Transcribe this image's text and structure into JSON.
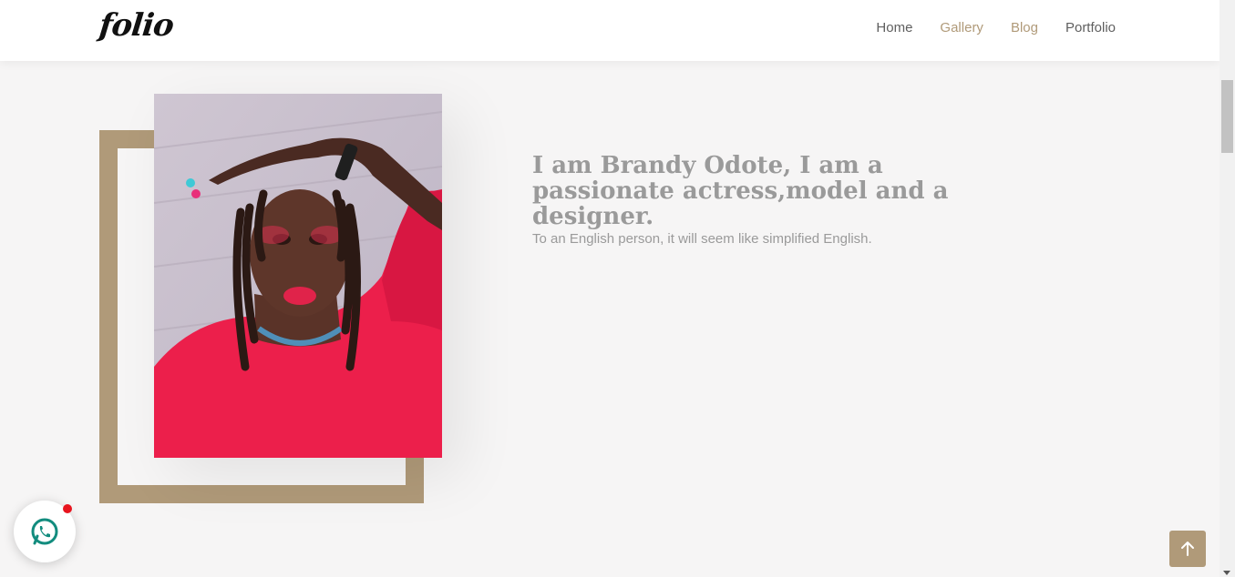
{
  "brand": {
    "logo_text": "folio"
  },
  "nav": {
    "items": [
      {
        "label": "Home",
        "color": "#5f5f5f"
      },
      {
        "label": "Gallery",
        "color": "#b09a79"
      },
      {
        "label": "Blog",
        "color": "#b09a79"
      },
      {
        "label": "Portfolio",
        "color": "#5f5f5f"
      }
    ]
  },
  "hero": {
    "headline": "I am Brandy Odote, I am a passionate actress,model and a designer.",
    "subtext": "To an English person, it will seem like simplified English."
  },
  "colors": {
    "accent": "#b09a79",
    "background": "#f6f5f5",
    "text_muted": "#9a9a9a",
    "whatsapp_green": "#128c7e",
    "notification_red": "#e8141e"
  },
  "icons": {
    "chat": "whatsapp-icon",
    "scroll_top": "arrow-up-icon"
  }
}
